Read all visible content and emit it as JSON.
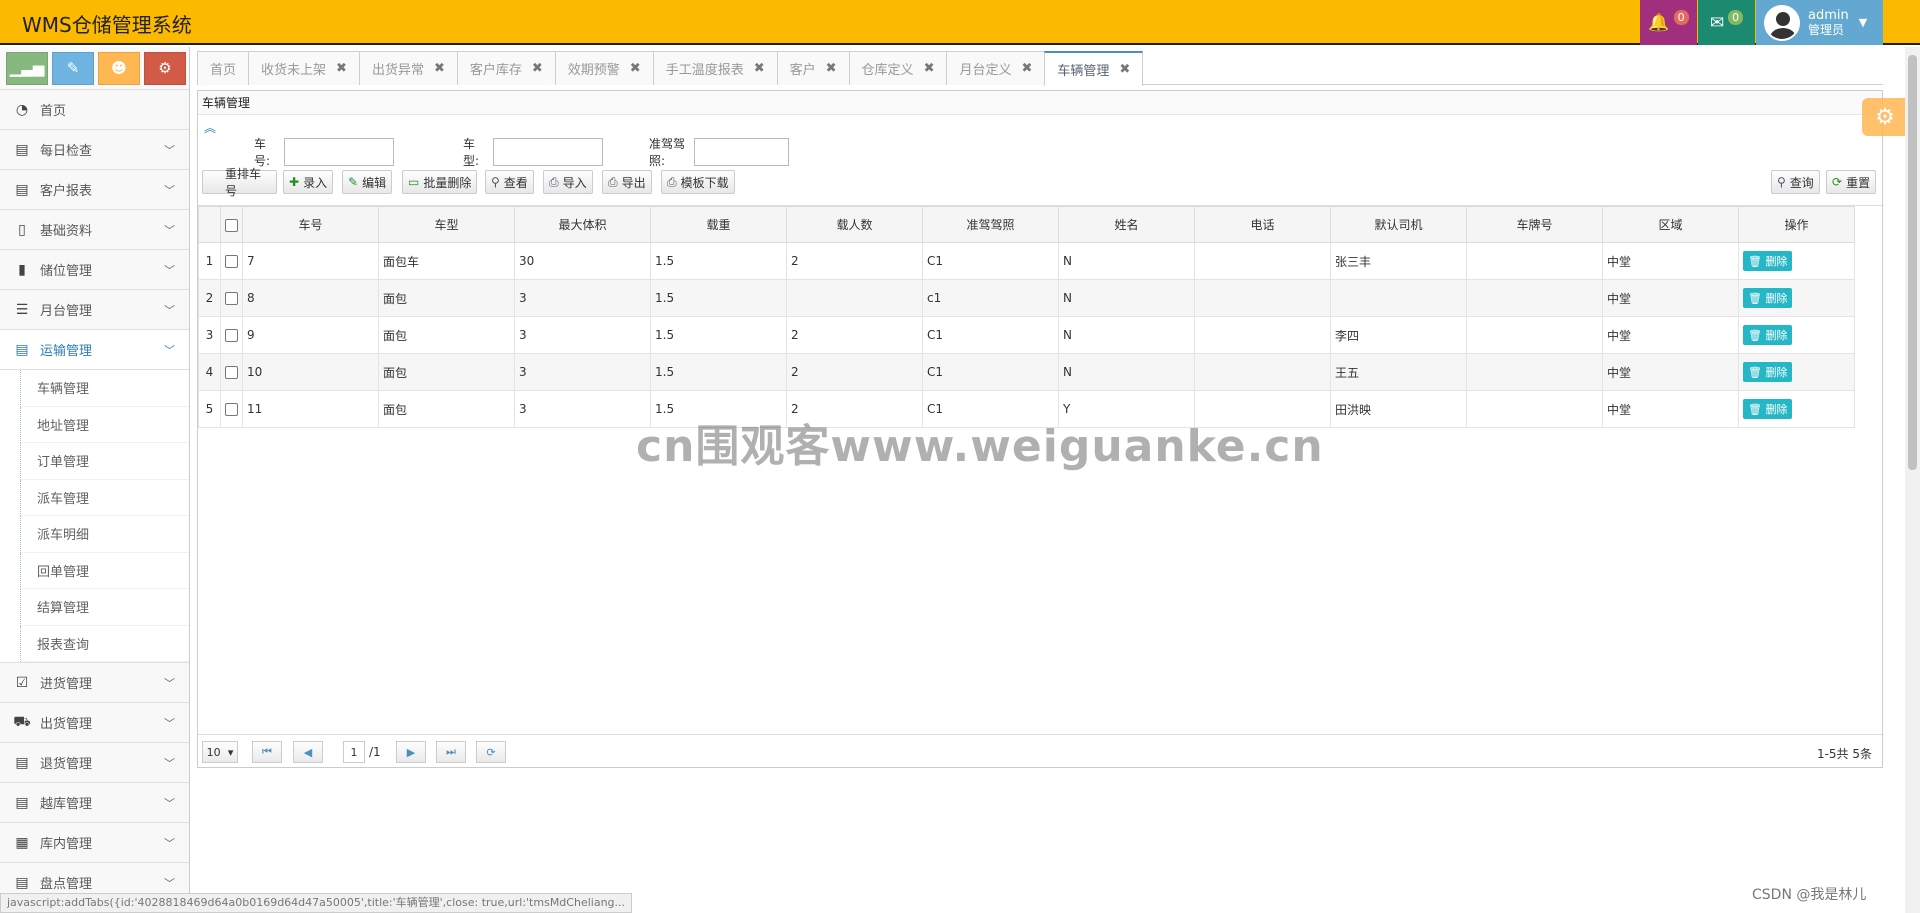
{
  "header": {
    "title": "WMS仓储管理系统",
    "notifications_count": "0",
    "messages_count": "0",
    "user_name": "admin",
    "user_role": "管理员"
  },
  "sidebar": {
    "home": "首页",
    "menus_top": [
      {
        "label": "每日检查",
        "icon": "table-icon"
      },
      {
        "label": "客户报表",
        "icon": "table-icon"
      },
      {
        "label": "基础资料",
        "icon": "file-icon"
      },
      {
        "label": "储位管理",
        "icon": "mobile-icon"
      },
      {
        "label": "月台管理",
        "icon": "list-icon"
      }
    ],
    "active_menu": "运输管理",
    "sub_items": [
      "车辆管理",
      "地址管理",
      "订单管理",
      "派车管理",
      "派车明细",
      "回单管理",
      "结算管理",
      "报表查询"
    ],
    "menus_bottom": [
      {
        "label": "进货管理",
        "icon": "check-square-icon"
      },
      {
        "label": "出货管理",
        "icon": "truck-icon"
      },
      {
        "label": "退货管理",
        "icon": "table-icon"
      },
      {
        "label": "越库管理",
        "icon": "table-icon"
      },
      {
        "label": "库内管理",
        "icon": "film-icon"
      },
      {
        "label": "盘点管理",
        "icon": "table-icon"
      }
    ]
  },
  "tabs": [
    "首页",
    "收货未上架",
    "出货异常",
    "客户库存",
    "效期预警",
    "手工温度报表",
    "客户",
    "仓库定义",
    "月台定义",
    "车辆管理"
  ],
  "panel": {
    "title": "车辆管理",
    "search": {
      "car_no": "车号:",
      "car_type": "车型:",
      "license": "准驾驾照:"
    },
    "toolbar": {
      "reorder": "重排车号",
      "add": "录入",
      "edit": "编辑",
      "batch_delete": "批量删除",
      "view": "查看",
      "import": "导入",
      "export": "导出",
      "template": "模板下载",
      "query": "查询",
      "reset": "重置"
    },
    "columns": [
      "车号",
      "车型",
      "最大体积",
      "载重",
      "载人数",
      "准驾驾照",
      "姓名",
      "电话",
      "默认司机",
      "车牌号",
      "区域",
      "操作"
    ],
    "rows": [
      {
        "n": "1",
        "car_no": "7",
        "type": "面包车",
        "volume": "30",
        "load": "1.5",
        "people": "2",
        "license": "C1",
        "name": "N",
        "phone": "",
        "driver": "张三丰",
        "plate": "",
        "area": "中堂",
        "action": "删除"
      },
      {
        "n": "2",
        "car_no": "8",
        "type": "面包",
        "volume": "3",
        "load": "1.5",
        "people": "",
        "license": "c1",
        "name": "N",
        "phone": "",
        "driver": "",
        "plate": "",
        "area": "中堂",
        "action": "删除"
      },
      {
        "n": "3",
        "car_no": "9",
        "type": "面包",
        "volume": "3",
        "load": "1.5",
        "people": "2",
        "license": "C1",
        "name": "N",
        "phone": "",
        "driver": "李四",
        "plate": "",
        "area": "中堂",
        "action": "删除"
      },
      {
        "n": "4",
        "car_no": "10",
        "type": "面包",
        "volume": "3",
        "load": "1.5",
        "people": "2",
        "license": "C1",
        "name": "N",
        "phone": "",
        "driver": "王五",
        "plate": "",
        "area": "中堂",
        "action": "删除"
      },
      {
        "n": "5",
        "car_no": "11",
        "type": "面包",
        "volume": "3",
        "load": "1.5",
        "people": "2",
        "license": "C1",
        "name": "Y",
        "phone": "",
        "driver": "田洪映",
        "plate": "",
        "area": "中堂",
        "action": "删除"
      }
    ],
    "pager": {
      "page_size": "10",
      "page": "1",
      "total_pages": "/1",
      "info": "1-5共 5条"
    }
  },
  "statusbar": "javascript:addTabs({id:'4028818469d64a0b0169d64d47a50005',title:'车辆管理',close: true,url:'tmsMdCheliang...",
  "watermark": "cn围观客www.weiguanke.cn",
  "csdn": "CSDN @我是林儿"
}
